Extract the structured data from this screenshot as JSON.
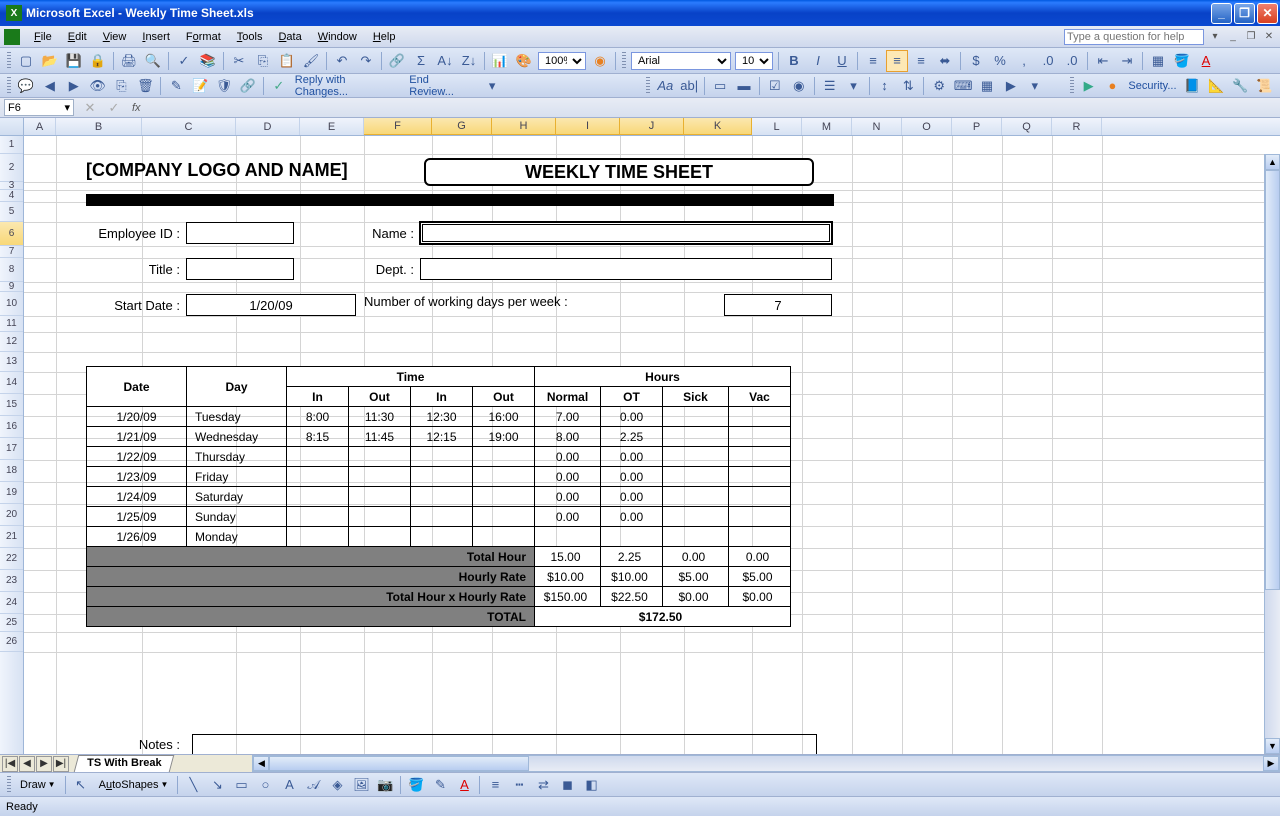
{
  "titlebar": {
    "title": "Microsoft Excel - Weekly Time Sheet.xls"
  },
  "menus": [
    "File",
    "Edit",
    "View",
    "Insert",
    "Format",
    "Tools",
    "Data",
    "Window",
    "Help"
  ],
  "helpbox_placeholder": "Type a question for help",
  "toolbar1": {
    "zoom": "100%",
    "font": "Arial",
    "size": "10"
  },
  "reply": {
    "label1": "Reply with Changes...",
    "label2": "End Review..."
  },
  "security_label": "Security...",
  "namebox": "F6",
  "columns": [
    {
      "l": "",
      "w": 24
    },
    {
      "l": "A",
      "w": 32
    },
    {
      "l": "B",
      "w": 86
    },
    {
      "l": "C",
      "w": 94
    },
    {
      "l": "D",
      "w": 64
    },
    {
      "l": "E",
      "w": 64
    },
    {
      "l": "F",
      "w": 68,
      "sel": true
    },
    {
      "l": "G",
      "w": 60,
      "sel": true
    },
    {
      "l": "H",
      "w": 64,
      "sel": true
    },
    {
      "l": "I",
      "w": 64,
      "sel": true
    },
    {
      "l": "J",
      "w": 64,
      "sel": true
    },
    {
      "l": "K",
      "w": 68,
      "sel": true
    },
    {
      "l": "L",
      "w": 50
    },
    {
      "l": "M",
      "w": 50
    },
    {
      "l": "N",
      "w": 50
    },
    {
      "l": "O",
      "w": 50
    },
    {
      "l": "P",
      "w": 50
    },
    {
      "l": "Q",
      "w": 50
    },
    {
      "l": "R",
      "w": 50
    }
  ],
  "rows": [
    {
      "n": "1",
      "h": 18
    },
    {
      "n": "2",
      "h": 28
    },
    {
      "n": "3",
      "h": 8
    },
    {
      "n": "4",
      "h": 12
    },
    {
      "n": "5",
      "h": 20
    },
    {
      "n": "6",
      "h": 24,
      "sel": true
    },
    {
      "n": "7",
      "h": 12
    },
    {
      "n": "8",
      "h": 24
    },
    {
      "n": "9",
      "h": 10
    },
    {
      "n": "10",
      "h": 24
    },
    {
      "n": "11",
      "h": 16
    },
    {
      "n": "12",
      "h": 20
    },
    {
      "n": "13",
      "h": 20
    },
    {
      "n": "14",
      "h": 22
    },
    {
      "n": "15",
      "h": 22
    },
    {
      "n": "16",
      "h": 22
    },
    {
      "n": "17",
      "h": 22
    },
    {
      "n": "18",
      "h": 22
    },
    {
      "n": "19",
      "h": 22
    },
    {
      "n": "20",
      "h": 22
    },
    {
      "n": "21",
      "h": 22
    },
    {
      "n": "22",
      "h": 22
    },
    {
      "n": "23",
      "h": 22
    },
    {
      "n": "24",
      "h": 22
    },
    {
      "n": "25",
      "h": 18
    },
    {
      "n": "26",
      "h": 20
    }
  ],
  "sheet": {
    "company": "[COMPANY LOGO AND NAME]",
    "title": "WEEKLY TIME SHEET",
    "employee_id_label": "Employee ID :",
    "name_label": "Name :",
    "title_label": "Title :",
    "dept_label": "Dept. :",
    "startdate_label": "Start Date :",
    "startdate_value": "1/20/09",
    "workdays_label": "Number of working days per week :",
    "workdays_value": "7",
    "notes_label": "Notes :",
    "table_headers": {
      "date": "Date",
      "day": "Day",
      "time": "Time",
      "in1": "In",
      "out1": "Out",
      "in2": "In",
      "out2": "Out",
      "hours": "Hours",
      "normal": "Normal",
      "ot": "OT",
      "sick": "Sick",
      "vac": "Vac"
    },
    "table_rows": [
      {
        "date": "1/20/09",
        "day": "Tuesday",
        "in1": "8:00",
        "out1": "11:30",
        "in2": "12:30",
        "out2": "16:00",
        "normal": "7.00",
        "ot": "0.00",
        "sick": "",
        "vac": ""
      },
      {
        "date": "1/21/09",
        "day": "Wednesday",
        "in1": "8:15",
        "out1": "11:45",
        "in2": "12:15",
        "out2": "19:00",
        "normal": "8.00",
        "ot": "2.25",
        "sick": "",
        "vac": ""
      },
      {
        "date": "1/22/09",
        "day": "Thursday",
        "in1": "",
        "out1": "",
        "in2": "",
        "out2": "",
        "normal": "0.00",
        "ot": "0.00",
        "sick": "",
        "vac": ""
      },
      {
        "date": "1/23/09",
        "day": "Friday",
        "in1": "",
        "out1": "",
        "in2": "",
        "out2": "",
        "normal": "0.00",
        "ot": "0.00",
        "sick": "",
        "vac": ""
      },
      {
        "date": "1/24/09",
        "day": "Saturday",
        "in1": "",
        "out1": "",
        "in2": "",
        "out2": "",
        "normal": "0.00",
        "ot": "0.00",
        "sick": "",
        "vac": ""
      },
      {
        "date": "1/25/09",
        "day": "Sunday",
        "in1": "",
        "out1": "",
        "in2": "",
        "out2": "",
        "normal": "0.00",
        "ot": "0.00",
        "sick": "",
        "vac": ""
      },
      {
        "date": "1/26/09",
        "day": "Monday",
        "in1": "",
        "out1": "",
        "in2": "",
        "out2": "",
        "normal": "",
        "ot": "",
        "sick": "",
        "vac": ""
      }
    ],
    "totals": {
      "total_hour_label": "Total Hour",
      "hourly_rate_label": "Hourly Rate",
      "txr_label": "Total Hour x Hourly Rate",
      "total_label": "TOTAL",
      "total_hour": [
        "15.00",
        "2.25",
        "0.00",
        "0.00"
      ],
      "hourly_rate": [
        "$10.00",
        "$10.00",
        "$5.00",
        "$5.00"
      ],
      "txr": [
        "$150.00",
        "$22.50",
        "$0.00",
        "$0.00"
      ],
      "grand_total": "$172.50"
    }
  },
  "sheettab": "TS With Break",
  "drawbar": {
    "draw": "Draw",
    "autoshapes": "AutoShapes"
  },
  "status": "Ready"
}
